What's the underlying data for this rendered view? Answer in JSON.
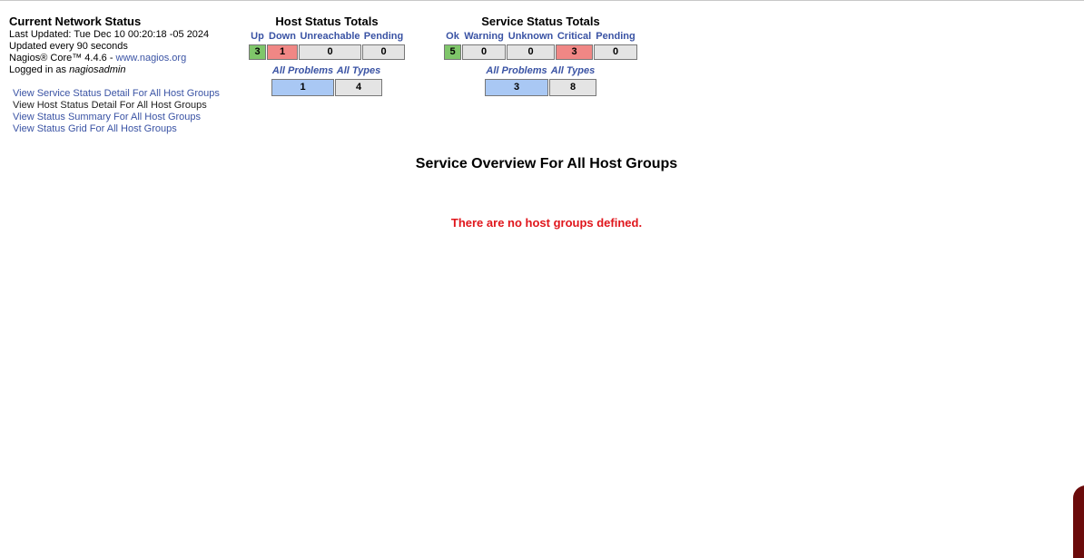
{
  "network": {
    "title": "Current Network Status",
    "last_updated": "Last Updated: Tue Dec 10 00:20:18 -05 2024",
    "update_interval": "Updated every 90 seconds",
    "version_prefix": "Nagios® Core™ 4.4.6 - ",
    "version_link": "www.nagios.org",
    "logged_in_prefix": "Logged in as ",
    "user": "nagiosadmin"
  },
  "links": [
    "View Service Status Detail For All Host Groups",
    "View Host Status Detail For All Host Groups",
    "View Status Summary For All Host Groups",
    "View Status Grid For All Host Groups"
  ],
  "host_totals": {
    "title": "Host Status Totals",
    "headers": [
      "Up",
      "Down",
      "Unreachable",
      "Pending"
    ],
    "values": [
      "3",
      "1",
      "0",
      "0"
    ],
    "summary_headers": [
      "All Problems",
      "All Types"
    ],
    "summary_values": [
      "1",
      "4"
    ]
  },
  "service_totals": {
    "title": "Service Status Totals",
    "headers": [
      "Ok",
      "Warning",
      "Unknown",
      "Critical",
      "Pending"
    ],
    "values": [
      "5",
      "0",
      "0",
      "3",
      "0"
    ],
    "summary_headers": [
      "All Problems",
      "All Types"
    ],
    "summary_values": [
      "3",
      "8"
    ]
  },
  "overview": {
    "title": "Service Overview For All Host Groups",
    "message": "There are no host groups defined."
  },
  "colors": {
    "ok": "#7fc66a",
    "problem": "#f08785",
    "summary": "#a9c8f4",
    "neutral": "#e4e4e4",
    "link": "#3a53a4",
    "error": "#e0161c"
  }
}
